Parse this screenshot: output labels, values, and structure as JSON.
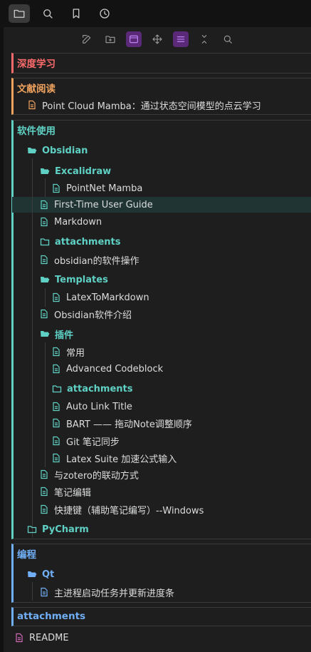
{
  "colors": {
    "red": "#ff6b6b",
    "orange": "#f0a35e",
    "teal": "#5fd1c4",
    "blue": "#70aef5",
    "pink": "#d36ab8"
  },
  "topbar": [
    "folder-icon",
    "search-icon",
    "bookmark-icon",
    "clock-icon"
  ],
  "sections": {
    "s1": "深度学习",
    "s2": "文献阅读",
    "s2_file": "Point Cloud Mamba：通过状态空间模型的点云学习",
    "s3": "软件使用",
    "s4": "编程",
    "s5": "attachments",
    "readme": "README"
  },
  "tree": {
    "obsidian": "Obsidian",
    "excalidraw": "Excalidraw",
    "pointnet": "PointNet Mamba",
    "firsttime": "First-Time User Guide",
    "markdown": "Markdown",
    "attach1": "attachments",
    "obsops": "obsidian的软件操作",
    "templates": "Templates",
    "latex2md": "LatexToMarkdown",
    "obsintro": "Obsidian软件介绍",
    "plugins": "插件",
    "common": "常用",
    "advcode": "Advanced Codeblock",
    "attach2": "attachments",
    "autolink": "Auto Link Title",
    "bart": "BART —— 拖动Note调整顺序",
    "git": "Git 笔记同步",
    "latexsuite": "Latex Suite 加速公式输入",
    "zotero": "与zotero的联动方式",
    "editing": "笔记编辑",
    "shortcut": "快捷键（辅助笔记编写）--Windows",
    "pycharm": "PyCharm",
    "qt": "Qt",
    "mainthread": "主进程启动任务并更新进度条"
  }
}
